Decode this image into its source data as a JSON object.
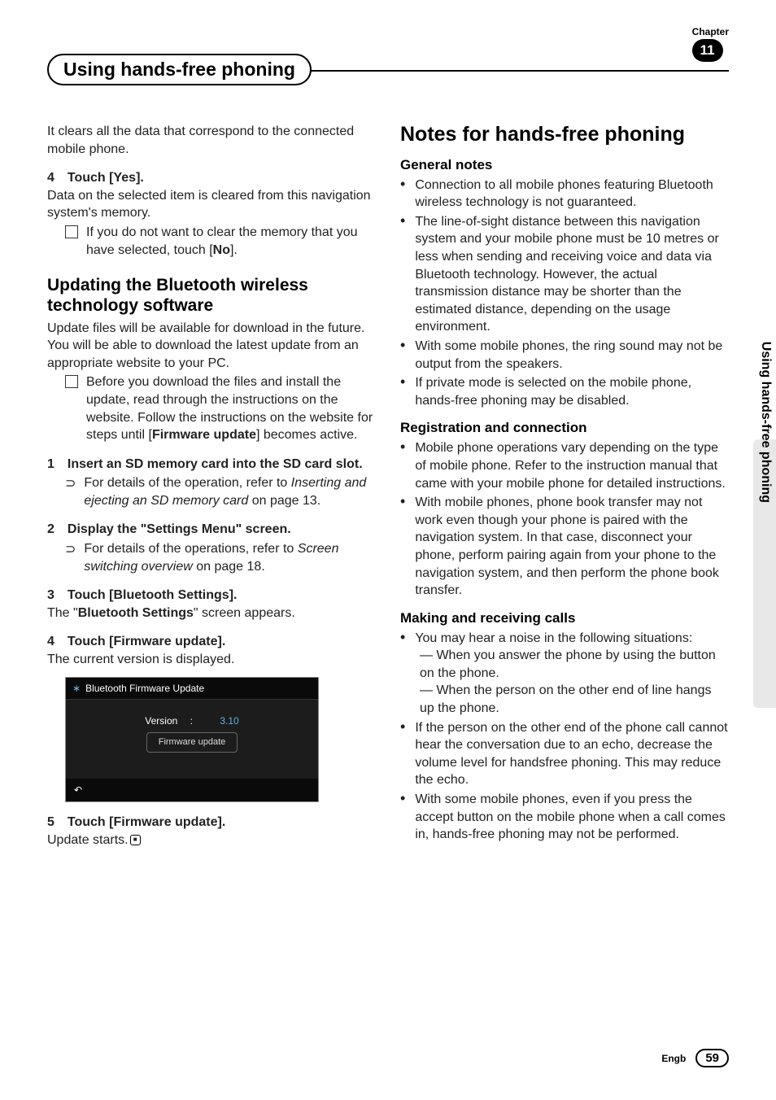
{
  "chapter": {
    "label": "Chapter",
    "number": "11"
  },
  "title": "Using hands-free phoning",
  "left": {
    "intro": "It clears all the data that correspond to the connected mobile phone.",
    "step4_head": "4 Touch [Yes].",
    "step4_body": "Data on the selected item is cleared from this navigation system's memory.",
    "step4_note_pre": "If you do not want to clear the memory that you have selected, touch [",
    "step4_note_bold": "No",
    "step4_note_post": "].",
    "h2": "Updating the Bluetooth wireless technology software",
    "h2_body": "Update files will be available for download in the future. You will be able to download the latest update from an appropriate website to your PC.",
    "h2_note_pre": "Before you download the files and install the update, read through the instructions on the website. Follow the instructions on the website for steps until [",
    "h2_note_bold": "Firmware update",
    "h2_note_post": "] becomes active.",
    "s1_head": "1 Insert an SD memory card into the SD card slot.",
    "s1_ref_pre": "For details of the operation, refer to ",
    "s1_ref_it": "Inserting and ejecting an SD memory card",
    "s1_ref_post": " on page 13.",
    "s2_head": "2 Display the \"Settings Menu\" screen.",
    "s2_ref_pre": "For details of the operations, refer to ",
    "s2_ref_it": "Screen switching overview",
    "s2_ref_post": " on page 18.",
    "s3_head": "3 Touch [Bluetooth Settings].",
    "s3_body_pre": "The \"",
    "s3_body_bold": "Bluetooth Settings",
    "s3_body_post": "\" screen appears.",
    "s4_head": "4 Touch [Firmware update].",
    "s4_body": "The current version is displayed.",
    "fw": {
      "title": "Bluetooth Firmware Update",
      "version_label": "Version",
      "colon": ":",
      "version_value": "3.10",
      "button": "Firmware update",
      "back": "↶"
    },
    "s5_head": "5 Touch [Firmware update].",
    "s5_body": "Update starts."
  },
  "right": {
    "h1": "Notes for hands-free phoning",
    "gen_h": "General notes",
    "gen": [
      "Connection to all mobile phones featuring Bluetooth wireless technology is not guaranteed.",
      "The line-of-sight distance between this navigation system and your mobile phone must be 10 metres or less when sending and receiving voice and data via Bluetooth technology. However, the actual transmission distance may be shorter than the estimated distance, depending on the usage environment.",
      "With some mobile phones, the ring sound may not be output from the speakers.",
      "If private mode is selected on the mobile phone, hands-free phoning may be disabled."
    ],
    "reg_h": "Registration and connection",
    "reg": [
      "Mobile phone operations vary depending on the type of mobile phone. Refer to the instruction manual that came with your mobile phone for detailed instructions.",
      "With mobile phones, phone book transfer may not work even though your phone is paired with the navigation system. In that case, disconnect your phone, perform pairing again from your phone to the navigation system, and then perform the phone book transfer."
    ],
    "call_h": "Making and receiving calls",
    "call1": "You may hear a noise in the following situations:",
    "call1_sub": [
      "— When you answer the phone by using the button on the phone.",
      "— When the person on the other end of line hangs up the phone."
    ],
    "call2": "If the person on the other end of the phone call cannot hear the conversation due to an echo, decrease the volume level for handsfree phoning. This may reduce the echo.",
    "call3": "With some mobile phones, even if you press the accept button on the mobile phone when a call comes in, hands-free phoning may not be performed."
  },
  "side_tab": "Using hands-free phoning",
  "footer": {
    "lang": "Engb",
    "page": "59"
  }
}
